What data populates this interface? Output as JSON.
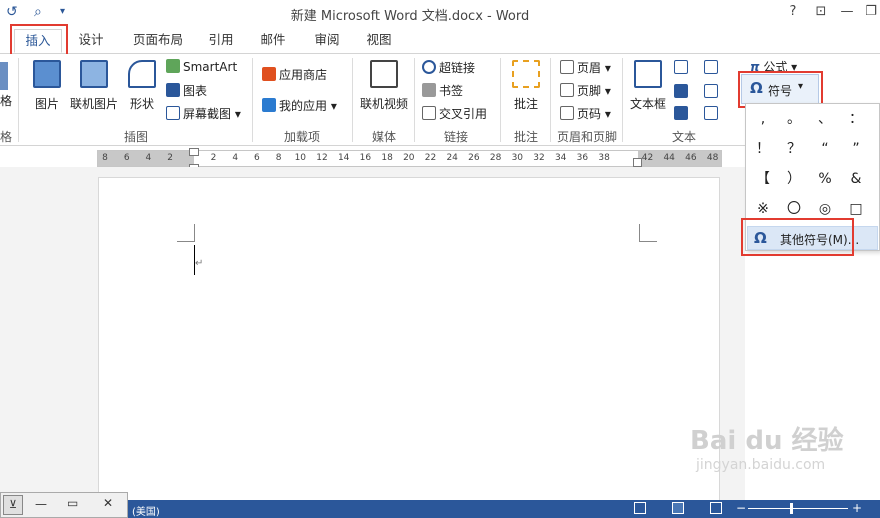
{
  "window": {
    "title": "新建 Microsoft Word 文档.docx - Word",
    "controls": [
      "?",
      "⊡",
      "—",
      "❐",
      "✕"
    ]
  },
  "tabs": [
    "插入",
    "设计",
    "页面布局",
    "引用",
    "邮件",
    "审阅",
    "视图"
  ],
  "active_tab": "插入",
  "ribbon": {
    "left_cut_label": "格",
    "left_cut_group": "格",
    "insert_group": {
      "picture": "图片",
      "online_picture": "联机图片",
      "shapes": "形状",
      "smartart": "SmartArt",
      "chart": "图表",
      "screenshot": "屏幕截图",
      "group_label": "插图"
    },
    "addins_group": {
      "store": "应用商店",
      "my_apps": "我的应用",
      "group_label": "加载项"
    },
    "media_group": {
      "online_video": "联机视频",
      "group_label": "媒体"
    },
    "links_group": {
      "hyperlink": "超链接",
      "bookmark": "书签",
      "cross_ref": "交叉引用",
      "group_label": "链接"
    },
    "comments_group": {
      "comment": "批注",
      "group_label": "批注"
    },
    "headerfooter_group": {
      "header": "页眉",
      "footer": "页脚",
      "page_number": "页码",
      "group_label": "页眉和页脚"
    },
    "text_group": {
      "textbox": "文本框",
      "group_label": "文本"
    },
    "symbols_group": {
      "equation": "公式",
      "symbol": "符号"
    }
  },
  "symbol_dropdown": {
    "symbols": [
      ",",
      "。",
      "、",
      "：",
      "！",
      "？",
      "“",
      "”",
      "【",
      "）",
      "%",
      "&",
      "※",
      "〇",
      "◎",
      "□"
    ],
    "more_label": "其他符号(M)..."
  },
  "ruler": {
    "ticks": [
      "8",
      "6",
      "4",
      "2",
      "",
      "2",
      "4",
      "6",
      "8",
      "10",
      "12",
      "14",
      "16",
      "18",
      "20",
      "22",
      "24",
      "26",
      "28",
      "30",
      "32",
      "34",
      "36",
      "38",
      "",
      "42",
      "44",
      "46",
      "48"
    ]
  },
  "status": {
    "language": "(美国)"
  },
  "float_window": {
    "pin": "⊻",
    "min": "—",
    "max": "▭",
    "close": "✕"
  },
  "watermark": {
    "brand": "Bai du 经验",
    "url": "jingyan.baidu.com"
  },
  "colors": {
    "accent": "#2b579a",
    "highlight": "#e23b30",
    "selected": "#dbe7f6"
  }
}
